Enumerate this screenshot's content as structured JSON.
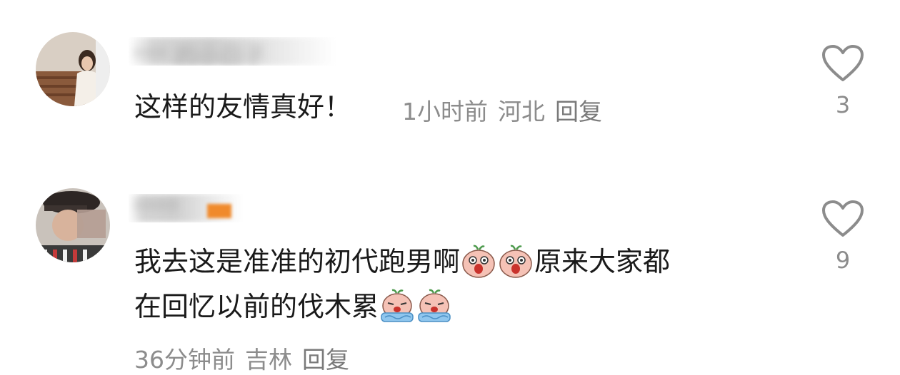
{
  "comments": [
    {
      "username": "*** 的小日子",
      "text": "这样的友情真好！",
      "time": "1小时前",
      "location": "河北",
      "reply_label": "回复",
      "likes": "3",
      "icon": "heart-outline-icon"
    },
    {
      "username": "**** ",
      "line1_a": "我去这是准准的初代跑男啊",
      "line1_b": "原来大家都",
      "line2": "在回忆以前的伐木累",
      "time": "36分钟前",
      "location": "吉林",
      "reply_label": "回复",
      "likes": "9",
      "icon": "heart-outline-icon"
    }
  ],
  "colors": {
    "text": "#1a1a1a",
    "meta": "#8c8c8c",
    "icon": "#8c8c8c"
  }
}
